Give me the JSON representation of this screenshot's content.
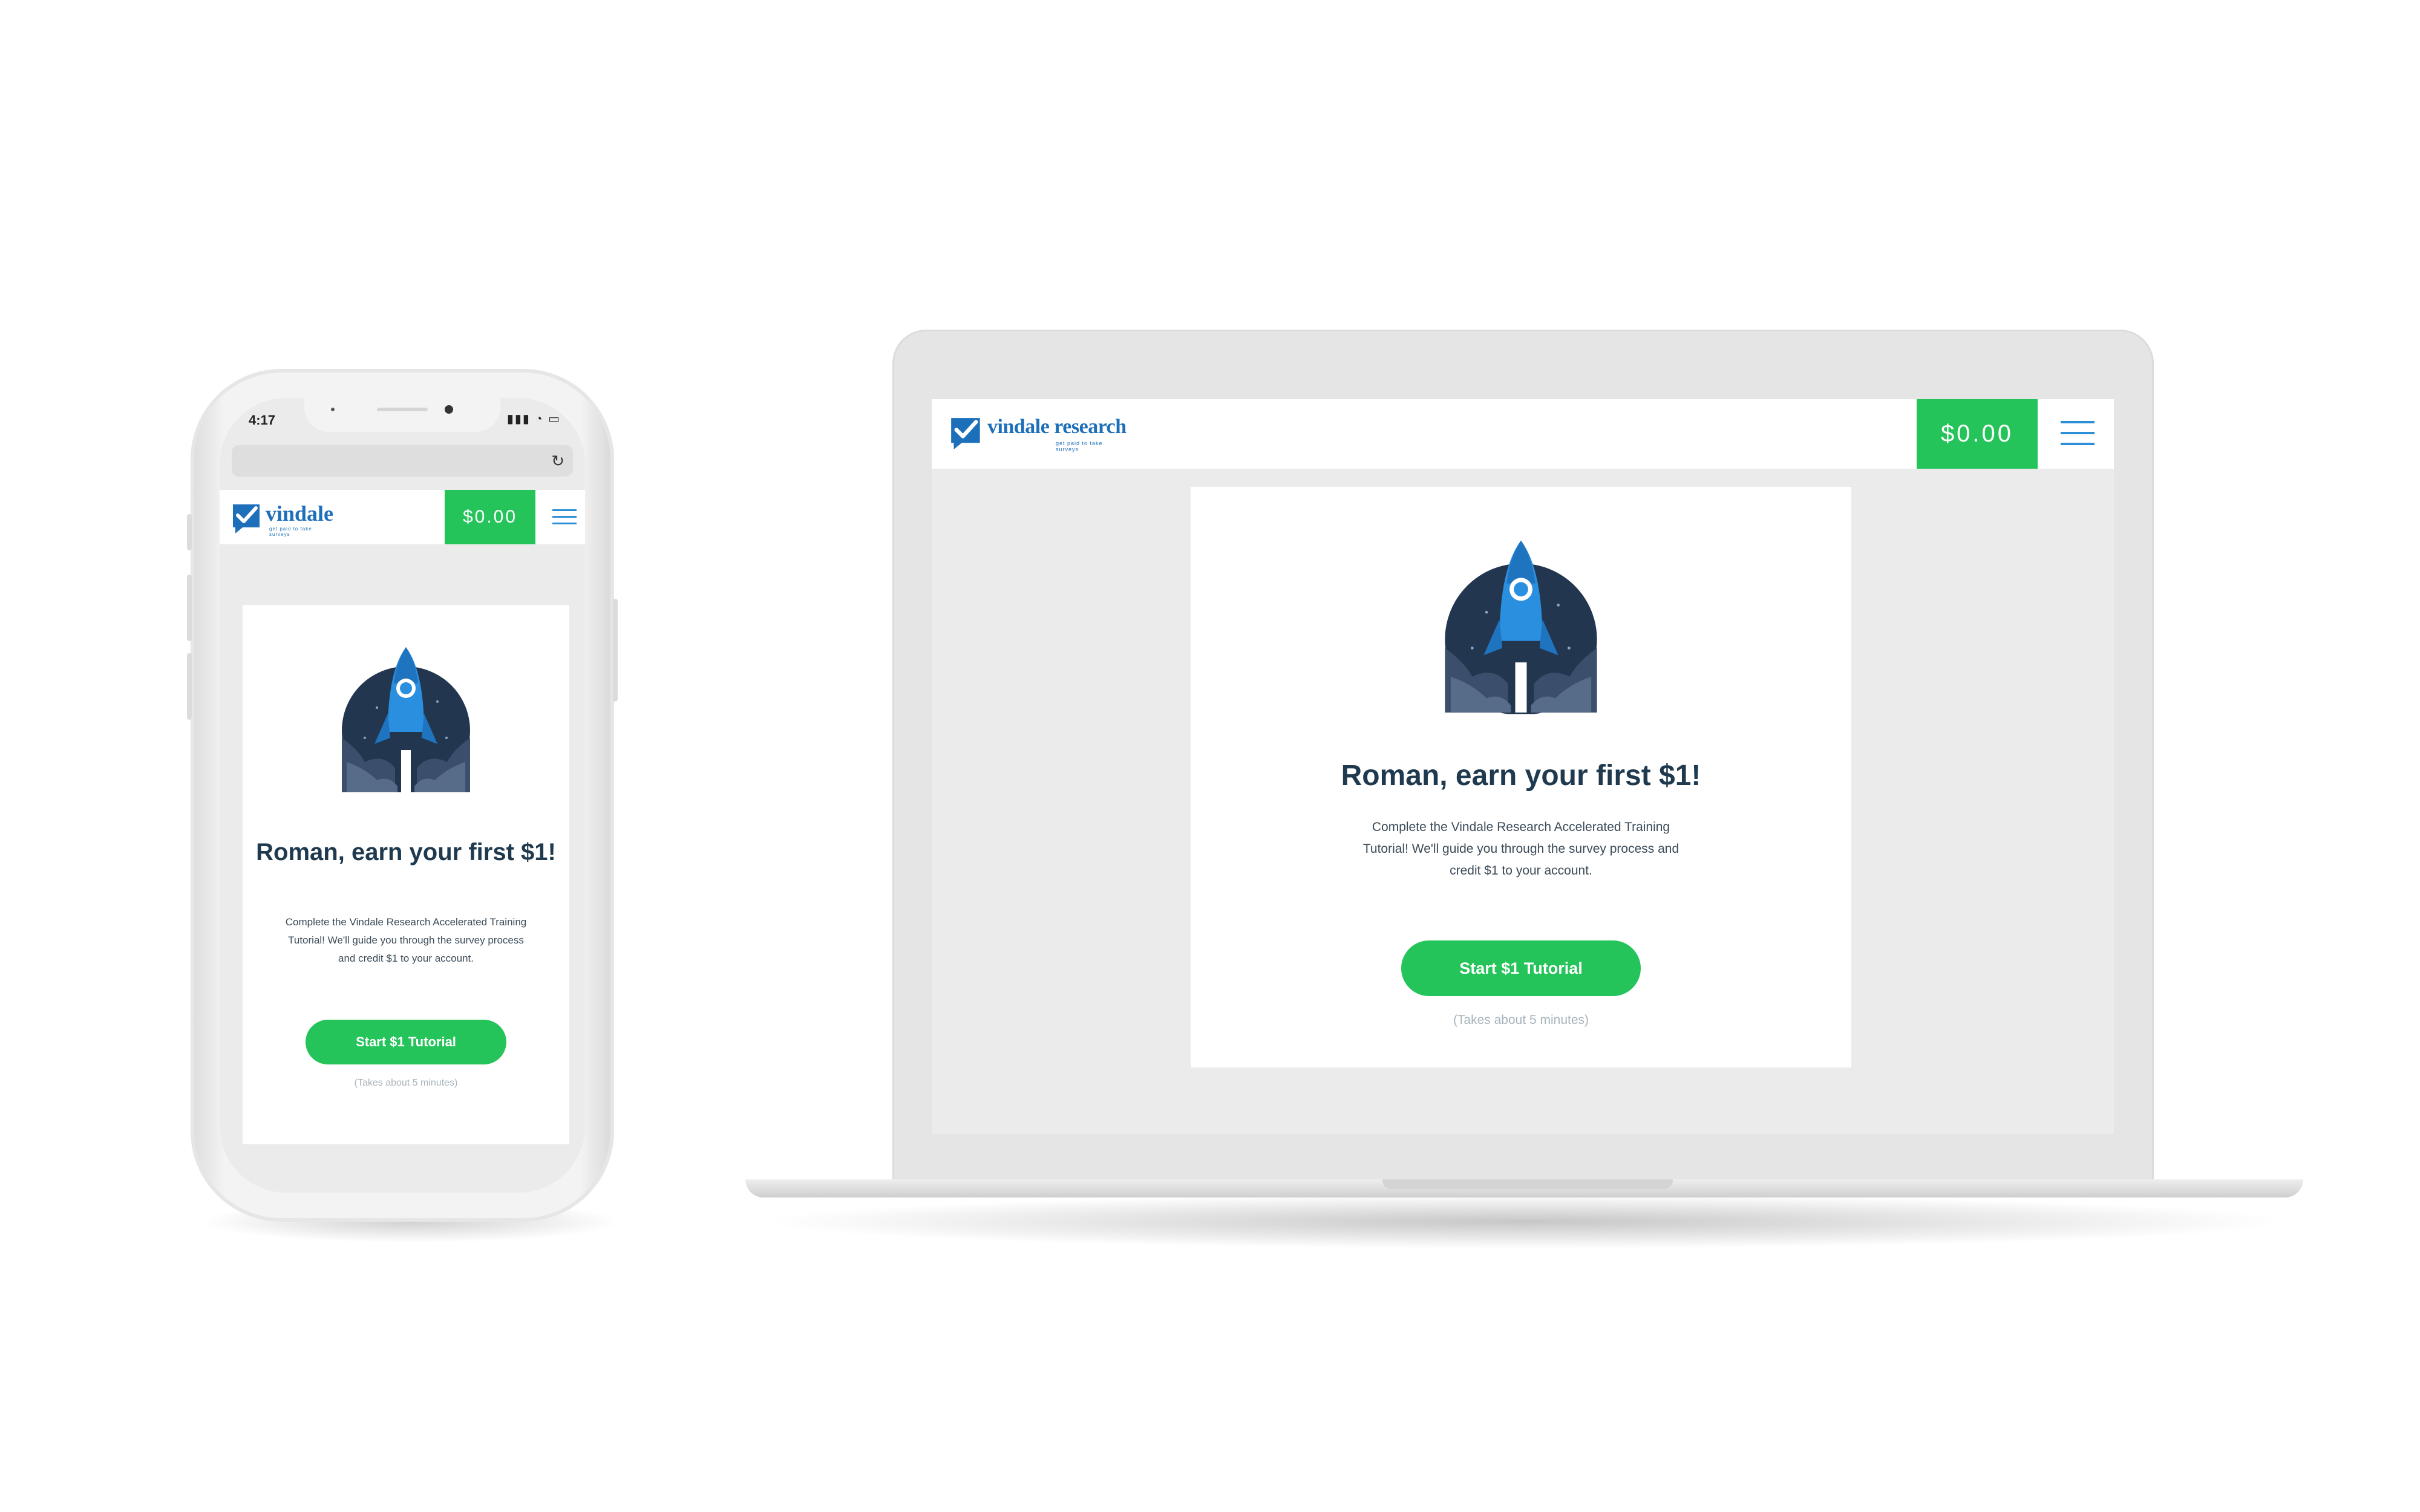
{
  "mobile": {
    "status_time": "4:17",
    "status_icons": "▮▮▮ ◔ ▭",
    "header": {
      "logo_text": "vindale",
      "logo_sub": "get paid to take surveys",
      "balance": "$0.00"
    },
    "card": {
      "title": "Roman, earn your first $1!",
      "description": "Complete the Vindale Research Accelerated Training Tutorial! We'll guide you through the survey process and credit $1 to your account.",
      "button": "Start $1 Tutorial",
      "note": "(Takes about 5 minutes)"
    }
  },
  "desktop": {
    "header": {
      "logo_text": "vindale research",
      "logo_sub": "get paid to take surveys",
      "balance": "$0.00"
    },
    "card": {
      "title": "Roman, earn your first $1!",
      "description": "Complete the Vindale Research Accelerated Training Tutorial! We'll guide you through the survey process and credit $1 to your account.",
      "button": "Start $1 Tutorial",
      "note": "(Takes about 5 minutes)"
    }
  },
  "colors": {
    "brand_blue": "#1d6fba",
    "accent_green": "#25c45a",
    "heading": "#1f3a4f"
  },
  "icons": [
    "checkmark-logo-icon",
    "hamburger-menu-icon",
    "rocket-icon",
    "reload-icon"
  ]
}
